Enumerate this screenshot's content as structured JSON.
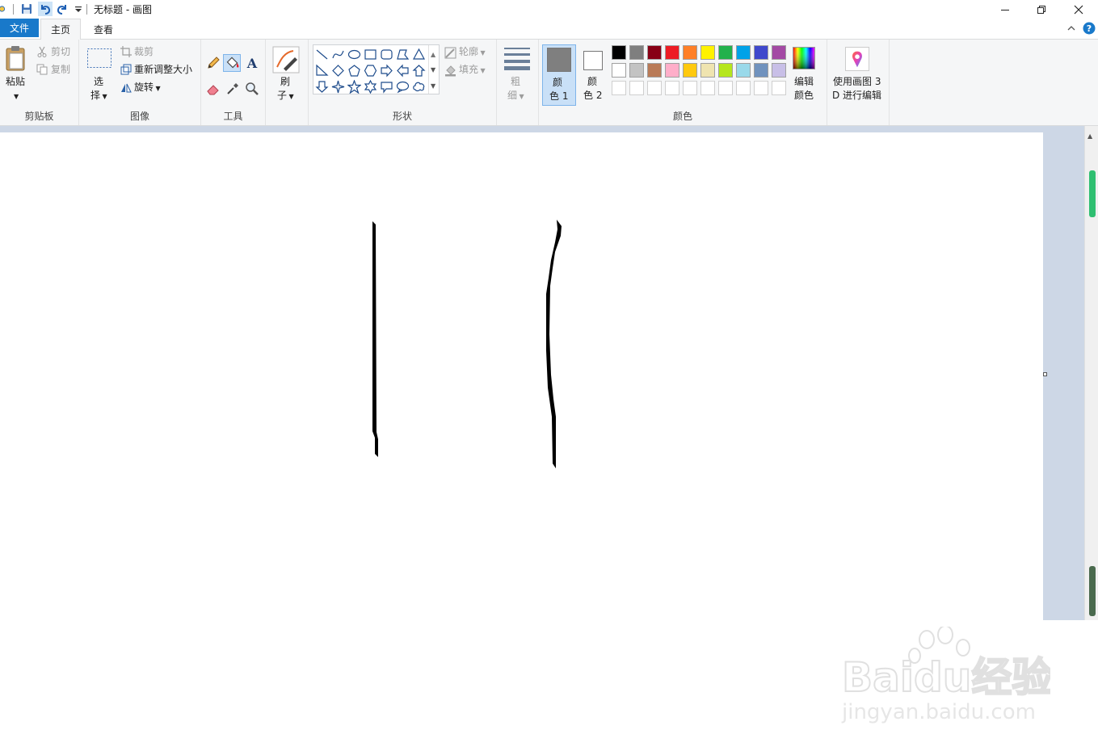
{
  "window": {
    "title": "无标题 - 画图"
  },
  "tabs": {
    "file": "文件",
    "home": "主页",
    "view": "查看"
  },
  "clipboard": {
    "paste": "粘贴",
    "cut": "剪切",
    "copy": "复制",
    "group_label": "剪贴板"
  },
  "image": {
    "select_line1": "选",
    "select_line2": "择",
    "crop": "裁剪",
    "resize": "重新调整大小",
    "rotate": "旋转",
    "group_label": "图像"
  },
  "tools": {
    "group_label": "工具"
  },
  "brushes": {
    "line1": "刷",
    "line2": "子"
  },
  "shapes": {
    "outline": "轮廓",
    "fill": "填充",
    "group_label": "形状"
  },
  "size": {
    "line1": "粗",
    "line2": "细"
  },
  "colors": {
    "color1_line1": "颜",
    "color1_line2": "色 1",
    "color2_line1": "颜",
    "color2_line2": "色 2",
    "edit_line1": "编辑",
    "edit_line2": "颜色",
    "group_label": "颜色",
    "color1_value": "#7f7f7f",
    "color2_value": "#ffffff",
    "palette_row1": [
      "#000000",
      "#7f7f7f",
      "#880015",
      "#ed1c24",
      "#ff7f27",
      "#fff200",
      "#22b14c",
      "#00a2e8",
      "#3f48cc",
      "#a349a4"
    ],
    "palette_row2": [
      "#ffffff",
      "#c3c3c3",
      "#b97a57",
      "#ffaec9",
      "#ffc90e",
      "#efe4b0",
      "#b5e61d",
      "#99d9ea",
      "#7092be",
      "#c8bfe7"
    ]
  },
  "paint3d": {
    "line1": "使用画图 3",
    "line2": "D 进行编辑"
  },
  "watermark": {
    "line1": "Baidu经验",
    "line2": "jingyan.baidu.com"
  }
}
